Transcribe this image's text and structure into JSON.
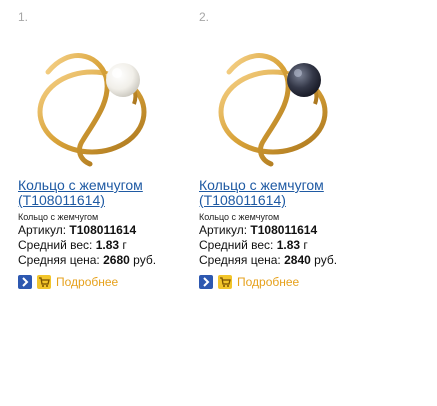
{
  "products": [
    {
      "index": "1.",
      "title": "Кольцо с жемчугом (Т108011614)",
      "subtitle": "Кольцо с жемчугом",
      "sku_label": "Артикул:",
      "sku": "Т108011614",
      "weight_label": "Средний вес:",
      "weight": "1.83",
      "weight_unit": "г",
      "price_label": "Средняя цена:",
      "price": "2680",
      "price_unit": "руб.",
      "more_label": "Подробнее",
      "pearl_color": "#f4f2ee"
    },
    {
      "index": "2.",
      "title": "Кольцо с жемчугом (Т108011614)",
      "subtitle": "Кольцо с жемчугом",
      "sku_label": "Артикул:",
      "sku": "Т108011614",
      "weight_label": "Средний вес:",
      "weight": "1.83",
      "weight_unit": "г",
      "price_label": "Средняя цена:",
      "price": "2840",
      "price_unit": "руб.",
      "more_label": "Подробнее",
      "pearl_color": "#2f3342"
    }
  ],
  "colors": {
    "link": "#1f5aa3",
    "more_link": "#e6a11c",
    "gold": "#d9a339",
    "more_button": "#2d58b0",
    "cart_button": "#f2c52b"
  },
  "icons": {
    "more": "chevron-right-icon",
    "cart": "cart-icon"
  }
}
